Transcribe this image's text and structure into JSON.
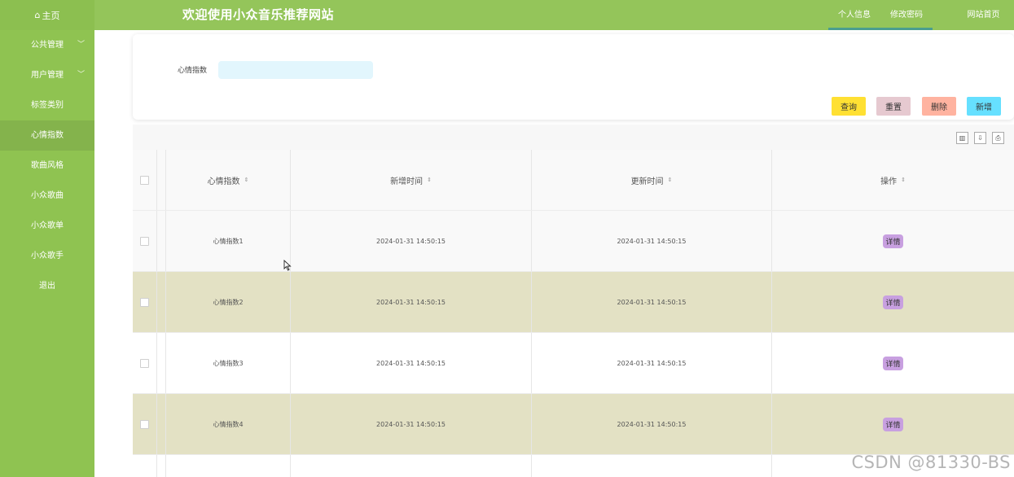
{
  "header": {
    "home_icon": "home-icon",
    "home_label": "主页",
    "title": "欢迎使用小众音乐推荐网站",
    "links": [
      "个人信息",
      "修改密码",
      "网站首页"
    ],
    "bg_color": "#94c55a"
  },
  "sidebar": {
    "items": [
      {
        "label": "公共管理",
        "expandable": true
      },
      {
        "label": "用户管理",
        "expandable": true
      },
      {
        "label": "标签类别"
      },
      {
        "label": "心情指数",
        "active": true
      },
      {
        "label": "歌曲风格"
      },
      {
        "label": "小众歌曲"
      },
      {
        "label": "小众歌单"
      },
      {
        "label": "小众歌手"
      },
      {
        "label": "退出"
      }
    ]
  },
  "search": {
    "label": "心情指数",
    "value": "",
    "placeholder": ""
  },
  "buttons": {
    "query": "查询",
    "reset": "重置",
    "delete": "删除",
    "add": "新增",
    "colors": {
      "query": "#ffe033",
      "reset": "#e6c9d0",
      "delete": "#ffb3a0",
      "add": "#66e0ff"
    }
  },
  "table": {
    "columns": [
      "心情指数",
      "新增时间",
      "更新时间",
      "操作"
    ],
    "rows": [
      {
        "mood": "心情指数1",
        "added": "2024-01-31 14:50:15",
        "updated": "2024-01-31 14:50:15",
        "action": "详情"
      },
      {
        "mood": "心情指数2",
        "added": "2024-01-31 14:50:15",
        "updated": "2024-01-31 14:50:15",
        "action": "详情"
      },
      {
        "mood": "心情指数3",
        "added": "2024-01-31 14:50:15",
        "updated": "2024-01-31 14:50:15",
        "action": "详情"
      },
      {
        "mood": "心情指数4",
        "added": "2024-01-31 14:50:15",
        "updated": "2024-01-31 14:50:15",
        "action": "详情"
      }
    ],
    "stripe_color": "#e3e1c4",
    "tool_icons": [
      "columns-icon",
      "export-icon",
      "print-icon"
    ]
  },
  "watermark": "CSDN @81330-BS"
}
